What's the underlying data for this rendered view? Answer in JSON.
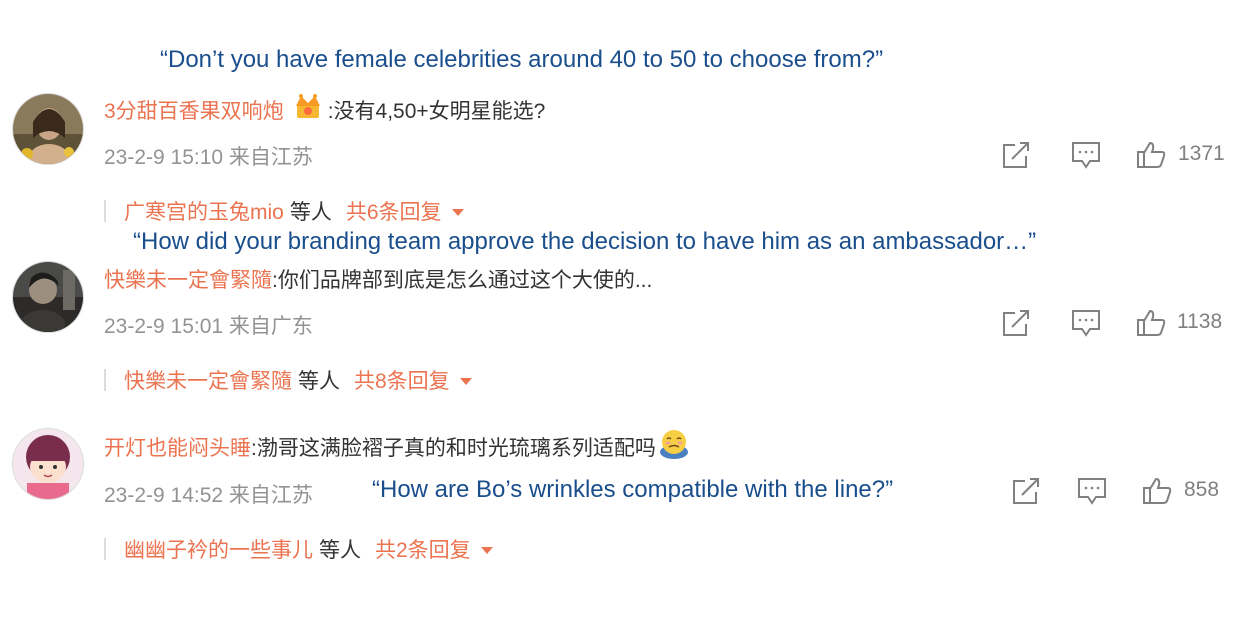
{
  "translations": {
    "t1": "“Don’t you have female celebrities around 40 to 50 to choose from?”",
    "t2": "“How did your branding team approve the decision to have him as an ambassador…”",
    "t3": "“How are Bo’s wrinkles compatible with the line?”"
  },
  "comments": [
    {
      "username": "3分甜百香果双响炮",
      "text": ":没有4,50+女明星能选?",
      "time": "23-2-9 15:10 来自江苏",
      "likes": "1371",
      "reply_user": "广寒宫的玉兔mio",
      "reply_others": "等人",
      "reply_count": "共6条回复",
      "badge_icon": "crown-badge-icon"
    },
    {
      "username": "快樂未一定會緊隨",
      "text": ":你们品牌部到底是怎么通过这个大使的...",
      "time": "23-2-9 15:01 来自广东",
      "likes": "1138",
      "reply_user": "快樂未一定會緊隨",
      "reply_others": "等人",
      "reply_count": "共8条回复"
    },
    {
      "username": "开灯也能闷头睡",
      "text": ":渤哥这满脸褶子真的和时光琉璃系列适配吗",
      "time": "23-2-9 14:52 来自江苏",
      "likes": "858",
      "reply_user": "幽幽子衿的一些事儿",
      "reply_others": "等人",
      "reply_count": "共2条回复",
      "emoji_icon": "worried-face-emoji-icon"
    }
  ],
  "icons": {
    "share": "share-icon",
    "comment": "comment-icon",
    "like": "thumbs-up-icon"
  },
  "colors": {
    "username": "#eb7350",
    "translation": "#1a4e8c",
    "meta": "#939393",
    "body_text": "#333333"
  }
}
